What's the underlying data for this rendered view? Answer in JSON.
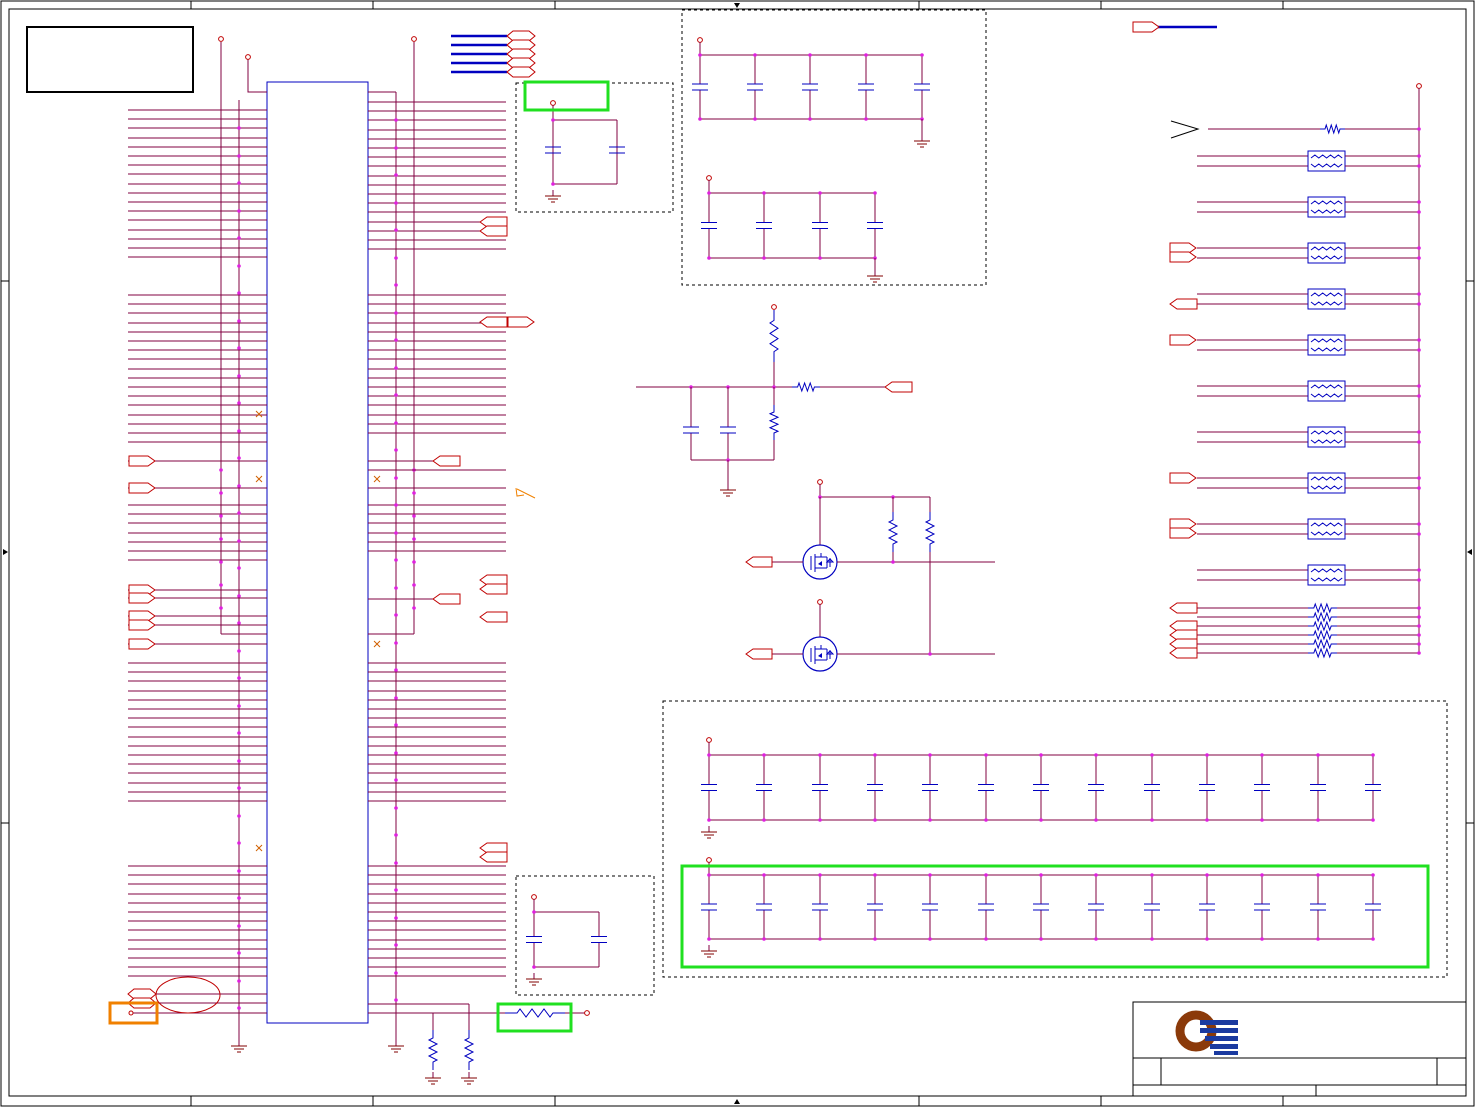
{
  "sheet": {
    "background": "#ffffff",
    "border_color": "#000000",
    "wire_color": "#800040",
    "component_color": "#0000c0",
    "port_color": "#c00000",
    "junction_color": "#e020e0",
    "power_color": "#c00000",
    "ground_color": "#800000",
    "highlight_green": "#20e020",
    "highlight_orange": "#f08000"
  },
  "title_block": {
    "logo_icon": "company-logo-icon",
    "logo_color_brown": "#8b3a0a",
    "logo_color_blue": "#1a3aa0"
  },
  "icons": {
    "mosfet": "mosfet-icon",
    "resistor": "resistor-icon",
    "resistor_array": "resistor-array-icon",
    "capacitor": "capacitor-icon",
    "ground": "ground-icon",
    "power": "power-pin-icon",
    "offpage_port": "offpage-port-icon",
    "no_connect": "no-connect-icon"
  }
}
